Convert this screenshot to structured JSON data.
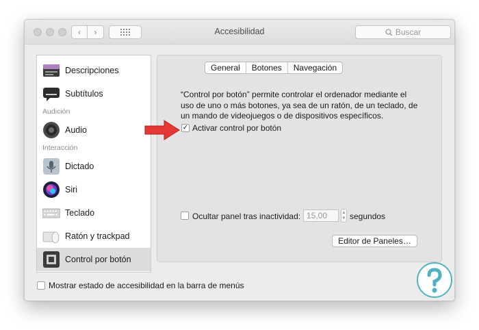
{
  "window": {
    "title": "Accesibilidad"
  },
  "toolbar": {
    "search_placeholder": "Buscar"
  },
  "sidebar": {
    "items": [
      {
        "label": "Descripciones",
        "icon": "descriptions-icon"
      },
      {
        "label": "Subtítulos",
        "icon": "subtitles-icon"
      },
      {
        "label": "Audio",
        "icon": "speaker-icon"
      },
      {
        "label": "Dictado",
        "icon": "microphone-icon"
      },
      {
        "label": "Siri",
        "icon": "siri-icon"
      },
      {
        "label": "Teclado",
        "icon": "keyboard-icon"
      },
      {
        "label": "Ratón y trackpad",
        "icon": "mouse-trackpad-icon"
      },
      {
        "label": "Control por botón",
        "icon": "switch-control-icon",
        "selected": true
      }
    ],
    "sections": {
      "audicion": "Audición",
      "interaccion": "Interacción"
    }
  },
  "tabs": [
    {
      "label": "General",
      "active": true
    },
    {
      "label": "Botones",
      "active": false
    },
    {
      "label": "Navegación",
      "active": false
    }
  ],
  "main": {
    "description": "“Control por botón” permite controlar el ordenador mediante el uso de uno o más botones, ya sea de un ratón, de un teclado, de un mando de videojuegos o de dispositivos específicos.",
    "enable_label": "Activar control por botón",
    "enable_checked": true,
    "hide_panel_label": "Ocultar panel tras inactividad:",
    "hide_panel_checked": false,
    "hide_panel_value": "15,00",
    "seconds_label": "segundos",
    "editor_button": "Editor de Paneles…"
  },
  "footer": {
    "menu_bar_label": "Mostrar estado de accesibilidad en la barra de menús",
    "menu_bar_checked": false
  },
  "colors": {
    "arrow": "#e53935",
    "watermark": "#4fb3bf"
  }
}
